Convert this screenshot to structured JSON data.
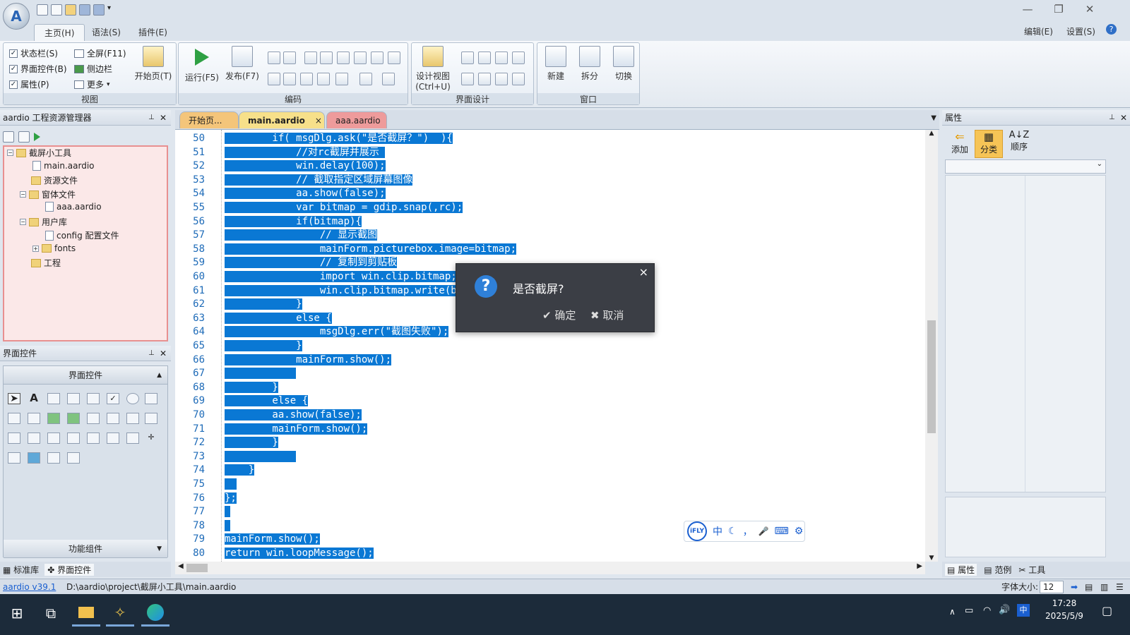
{
  "app": {
    "logo_glyph": "A"
  },
  "window": {
    "minimize": "—",
    "restore": "❐",
    "close": "✕"
  },
  "ribbon_tabs": [
    {
      "label": "主页(H)"
    },
    {
      "label": "语法(S)"
    },
    {
      "label": "插件(E)"
    }
  ],
  "right_menu": {
    "edit": "编辑(E)",
    "settings": "设置(S)",
    "help": "?"
  },
  "ribbon": {
    "view": {
      "title": "视图",
      "statusbar": "状态栏(S)",
      "controls": "界面控件(B)",
      "props": "属性(P)",
      "fullscreen": "全屏(F11)",
      "sidebar": "侧边栏",
      "more": "更多",
      "start_page": "开始页(T)"
    },
    "code": {
      "title": "编码",
      "run": "运行(F5)",
      "publish": "发布(F7)"
    },
    "design": {
      "title": "界面设计",
      "design_view_1": "设计视图",
      "design_view_2": "(Ctrl+U)"
    },
    "window_group": {
      "title": "窗口",
      "new": "新建",
      "split": "拆分",
      "switch": "切换"
    }
  },
  "project_panel": {
    "title": "aardio 工程资源管理器",
    "tree": [
      {
        "label": "截屏小工具"
      },
      {
        "label": "main.aardio"
      },
      {
        "label": "资源文件"
      },
      {
        "label": "窗体文件"
      },
      {
        "label": "aaa.aardio"
      },
      {
        "label": "用户库"
      },
      {
        "label": "config 配置文件"
      },
      {
        "label": "fonts"
      },
      {
        "label": "工程"
      }
    ]
  },
  "controls_panel": {
    "title": "界面控件",
    "header": "界面控件",
    "footer": "功能组件",
    "tab_std": "标准库",
    "tab_ctrl": "界面控件"
  },
  "doc_tabs": [
    {
      "label": "开始页..."
    },
    {
      "label": "main.aardio"
    },
    {
      "label": "aaa.aardio"
    }
  ],
  "code_lines": [
    {
      "n": "50",
      "code": "        if( msgDlg.ask(\"是否截屏？\")  ){"
    },
    {
      "n": "51",
      "code": "            //对rc截屏并展示 "
    },
    {
      "n": "52",
      "code": "            win.delay(100);"
    },
    {
      "n": "53",
      "code": "            // 截取指定区域屏幕图像"
    },
    {
      "n": "54",
      "code": "            aa.show(false);"
    },
    {
      "n": "55",
      "code": "            var bitmap = gdip.snap(,rc);"
    },
    {
      "n": "56",
      "code": "            if(bitmap){"
    },
    {
      "n": "57",
      "code": "                // 显示截图"
    },
    {
      "n": "58",
      "code": "                mainForm.picturebox.image=bitmap;"
    },
    {
      "n": "59",
      "code": "                // 复制到剪贴板"
    },
    {
      "n": "60",
      "code": "                import win.clip.bitmap;"
    },
    {
      "n": "61",
      "code": "                win.clip.bitmap.write(bitmap);"
    },
    {
      "n": "62",
      "code": "            }"
    },
    {
      "n": "63",
      "code": "            else {"
    },
    {
      "n": "64",
      "code": "                msgDlg.err(\"截图失败\");"
    },
    {
      "n": "65",
      "code": "            }"
    },
    {
      "n": "66",
      "code": "            mainForm.show();"
    },
    {
      "n": "67",
      "code": "            "
    },
    {
      "n": "68",
      "code": "        }"
    },
    {
      "n": "69",
      "code": "        else {"
    },
    {
      "n": "70",
      "code": "        aa.show(false);"
    },
    {
      "n": "71",
      "code": "        mainForm.show();"
    },
    {
      "n": "72",
      "code": "        }"
    },
    {
      "n": "73",
      "code": "            "
    },
    {
      "n": "74",
      "code": "    }"
    },
    {
      "n": "75",
      "code": "  "
    },
    {
      "n": "76",
      "code": "};"
    },
    {
      "n": "77",
      "code": " "
    },
    {
      "n": "78",
      "code": " "
    },
    {
      "n": "79",
      "code": "mainForm.show();"
    },
    {
      "n": "80",
      "code": "return win.loopMessage();"
    }
  ],
  "dialog": {
    "question": "是否截屏?",
    "ok": "确定",
    "cancel": "取消",
    "close": "×",
    "icon": "?"
  },
  "ifly": {
    "brand": "iFLY",
    "zh": "中",
    "moon": "☾",
    "punct": "，",
    "mic": "🎤",
    "kbd": "⌨",
    "gear": "⚙"
  },
  "props_panel": {
    "title": "属性",
    "add": "添加",
    "category": "分类",
    "order": "顺序",
    "tab_props": "属性",
    "tab_examples": "范例",
    "tab_tools": "工具"
  },
  "statusbar": {
    "version": "aardio v39.1",
    "path": "D:\\aardio\\project\\截屏小工具\\main.aardio",
    "font_size_label": "字体大小:",
    "font_size": "12"
  },
  "taskbar": {
    "time": "17:28",
    "date": "2025/5/9",
    "ime": "中"
  },
  "colors": {
    "selection": "#0a78d4",
    "line_number": "#1e6bb8",
    "dialog_bg": "#3b3e45"
  }
}
